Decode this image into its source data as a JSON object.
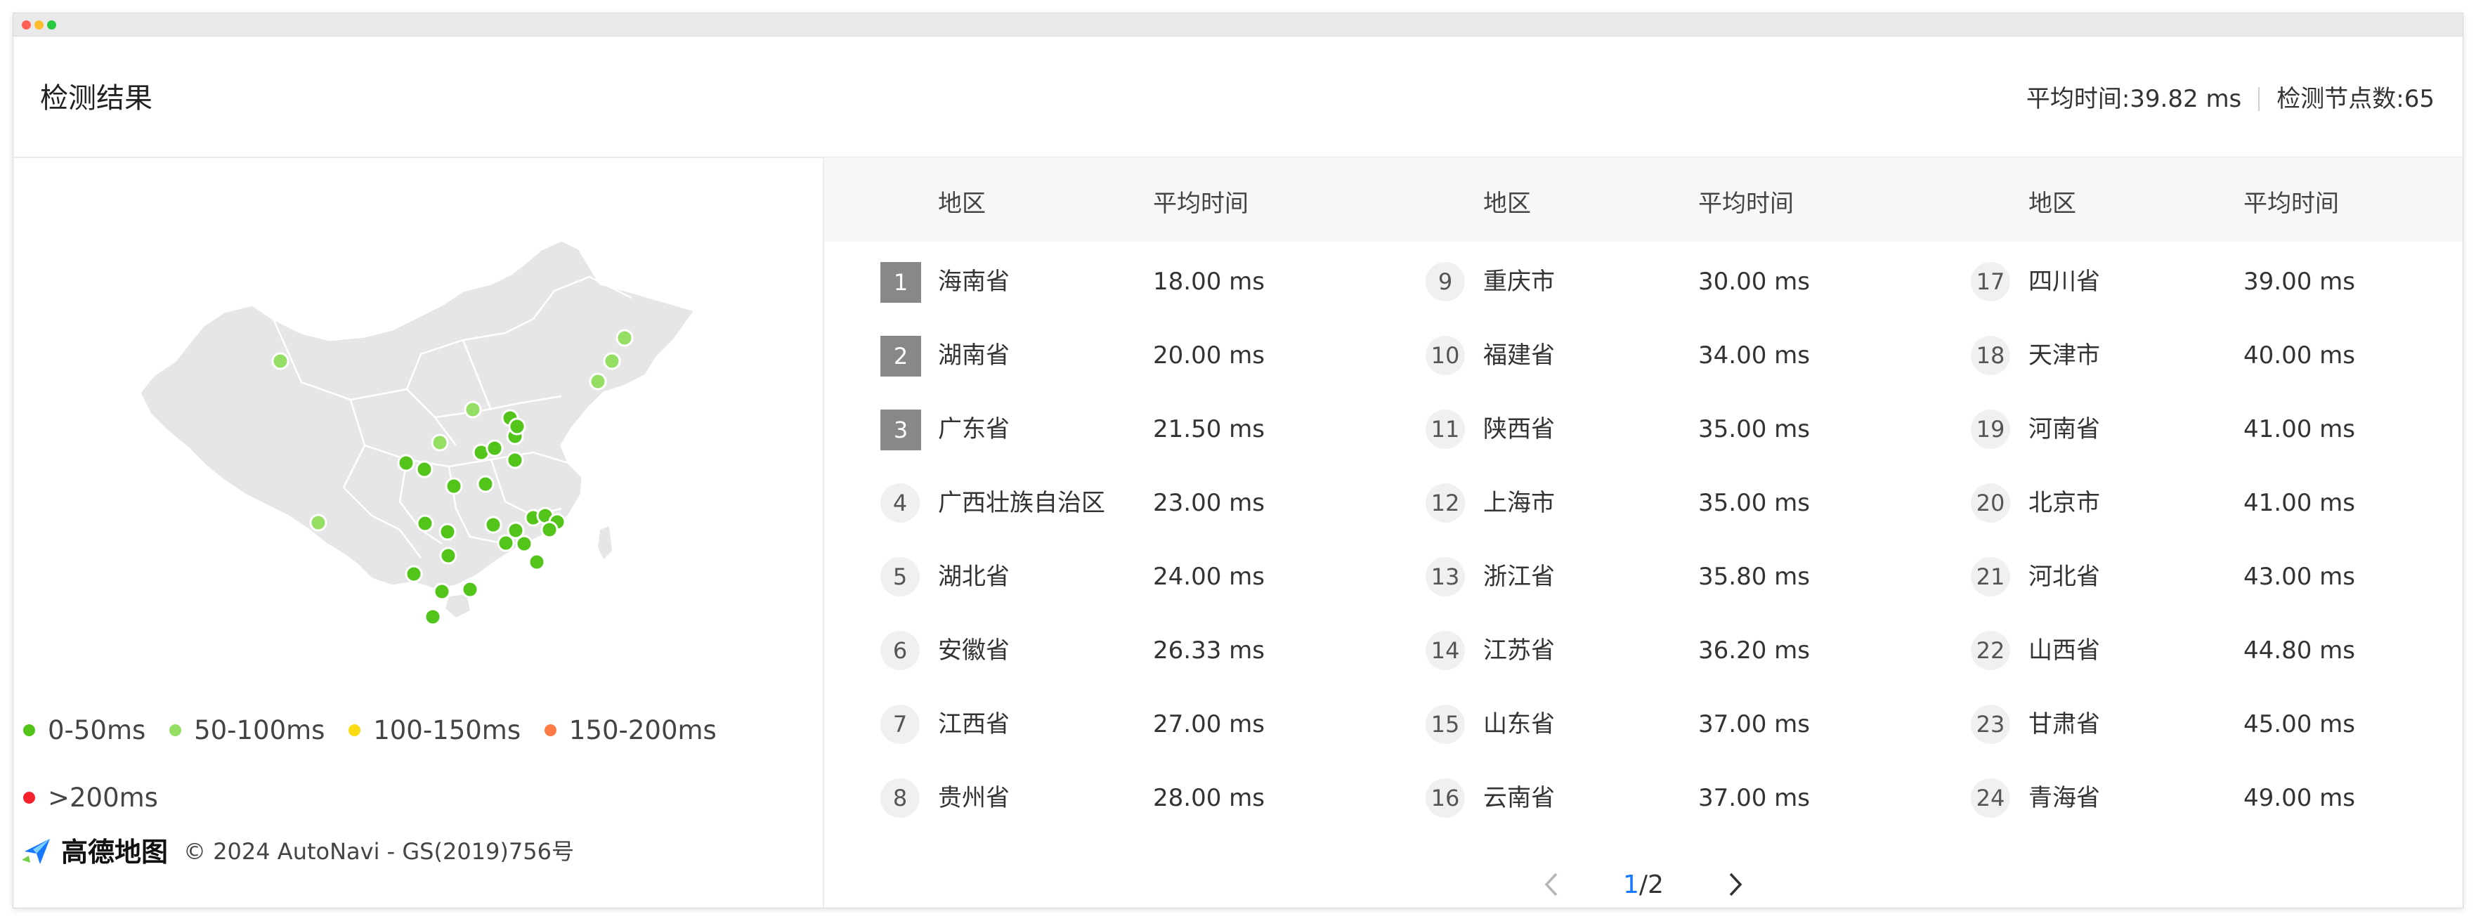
{
  "panel": {
    "title": "检测结果",
    "avg_time": "平均时间:39.82 ms",
    "node_count": "检测节点数:65"
  },
  "legend": [
    {
      "label": "0-50ms",
      "color": "#52c41a"
    },
    {
      "label": "50-100ms",
      "color": "#95de64"
    },
    {
      "label": "100-150ms",
      "color": "#fadb14"
    },
    {
      "label": "150-200ms",
      "color": "#ff7a45"
    },
    {
      "label": ">200ms",
      "color": "#f5222d"
    }
  ],
  "map": {
    "credit": "© 2024 AutoNavi - GS(2019)756号",
    "brand": "高德地图",
    "land_color": "#e6e6e6",
    "border_color": "#ffffff",
    "marker_color": "#52c41a",
    "marker_light_color": "#95de64"
  },
  "table": {
    "headers": {
      "region": "地区",
      "avg": "平均时间"
    },
    "columns": [
      [
        {
          "rank": "1",
          "region": "海南省",
          "time": "18.00 ms"
        },
        {
          "rank": "2",
          "region": "湖南省",
          "time": "20.00 ms"
        },
        {
          "rank": "3",
          "region": "广东省",
          "time": "21.50 ms"
        },
        {
          "rank": "4",
          "region": "广西壮族自治区",
          "time": "23.00 ms"
        },
        {
          "rank": "5",
          "region": "湖北省",
          "time": "24.00 ms"
        },
        {
          "rank": "6",
          "region": "安徽省",
          "time": "26.33 ms"
        },
        {
          "rank": "7",
          "region": "江西省",
          "time": "27.00 ms"
        },
        {
          "rank": "8",
          "region": "贵州省",
          "time": "28.00 ms"
        }
      ],
      [
        {
          "rank": "9",
          "region": "重庆市",
          "time": "30.00 ms"
        },
        {
          "rank": "10",
          "region": "福建省",
          "time": "34.00 ms"
        },
        {
          "rank": "11",
          "region": "陕西省",
          "time": "35.00 ms"
        },
        {
          "rank": "12",
          "region": "上海市",
          "time": "35.00 ms"
        },
        {
          "rank": "13",
          "region": "浙江省",
          "time": "35.80 ms"
        },
        {
          "rank": "14",
          "region": "江苏省",
          "time": "36.20 ms"
        },
        {
          "rank": "15",
          "region": "山东省",
          "time": "37.00 ms"
        },
        {
          "rank": "16",
          "region": "云南省",
          "time": "37.00 ms"
        }
      ],
      [
        {
          "rank": "17",
          "region": "四川省",
          "time": "39.00 ms"
        },
        {
          "rank": "18",
          "region": "天津市",
          "time": "40.00 ms"
        },
        {
          "rank": "19",
          "region": "河南省",
          "time": "41.00 ms"
        },
        {
          "rank": "20",
          "region": "北京市",
          "time": "41.00 ms"
        },
        {
          "rank": "21",
          "region": "河北省",
          "time": "43.00 ms"
        },
        {
          "rank": "22",
          "region": "山西省",
          "time": "44.80 ms"
        },
        {
          "rank": "23",
          "region": "甘肃省",
          "time": "45.00 ms"
        },
        {
          "rank": "24",
          "region": "青海省",
          "time": "49.00 ms"
        }
      ]
    ]
  },
  "pager": {
    "current": "1",
    "total": "/2"
  }
}
